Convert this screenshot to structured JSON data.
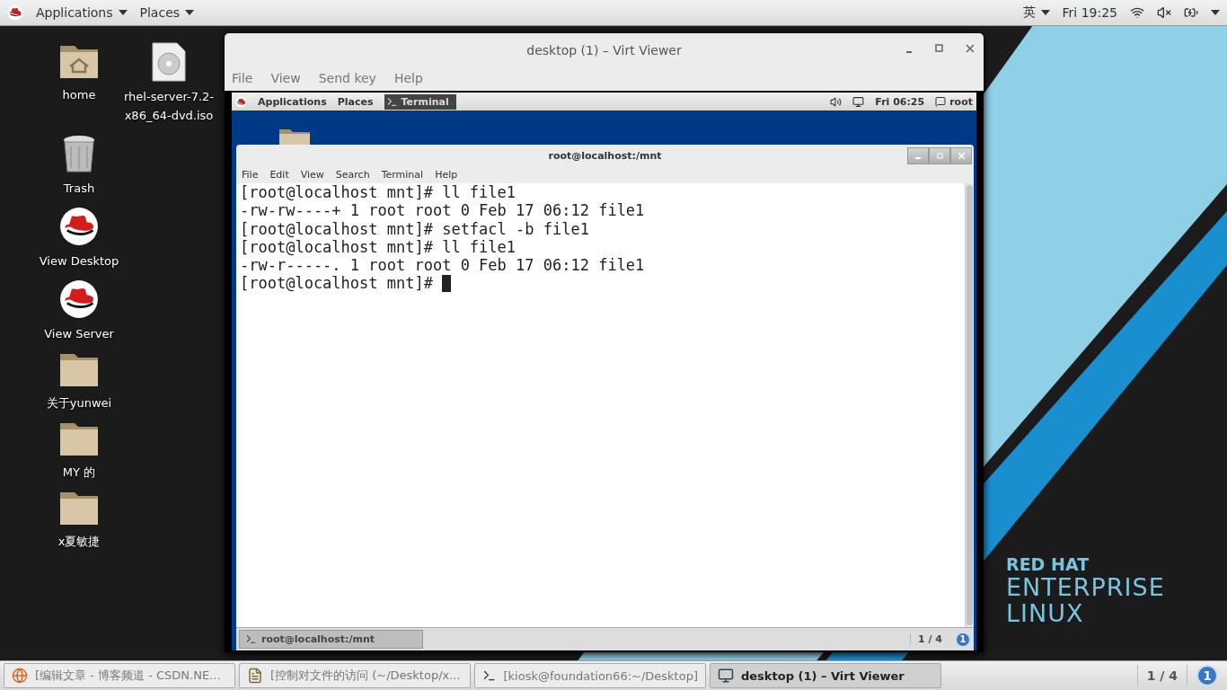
{
  "top_bar": {
    "menus": [
      {
        "label": "Applications"
      },
      {
        "label": "Places"
      }
    ],
    "input_method": "英",
    "clock": "Fri 19:25"
  },
  "desktop_icons": [
    {
      "kind": "home",
      "label": "home"
    },
    {
      "kind": "disc",
      "label": "rhel-server-7.2-x86_64-dvd.iso"
    },
    {
      "kind": "trash",
      "label": "Trash"
    },
    {
      "kind": "redhat",
      "label": "View Desktop"
    },
    {
      "kind": "redhat",
      "label": "View Server"
    },
    {
      "kind": "folder",
      "label": "关于yunwei"
    },
    {
      "kind": "folder",
      "label": "MY 的"
    },
    {
      "kind": "folder",
      "label": "x夏敏捷"
    }
  ],
  "viewer_window": {
    "title": "desktop (1) – Virt Viewer",
    "menus": [
      "File",
      "View",
      "Send key",
      "Help"
    ],
    "guest": {
      "top_bar": {
        "menus": [
          "Applications",
          "Places"
        ],
        "active_app": "Terminal",
        "clock": "Fri 06:25",
        "user": "root"
      },
      "terminal": {
        "title": "root@localhost:/mnt",
        "menus": [
          "File",
          "Edit",
          "View",
          "Search",
          "Terminal",
          "Help"
        ],
        "lines": [
          "[root@localhost mnt]# ll file1",
          "-rw-rw----+ 1 root root 0 Feb 17 06:12 file1",
          "[root@localhost mnt]# setfacl -b file1",
          "[root@localhost mnt]# ll file1",
          "-rw-r-----. 1 root root 0 Feb 17 06:12 file1",
          "[root@localhost mnt]# "
        ]
      },
      "taskbar": {
        "items": [
          {
            "label": "root@localhost:/mnt",
            "selected": true
          }
        ],
        "pager": "1 / 4",
        "badge": "1"
      }
    }
  },
  "branding": {
    "line_1": "RED HAT",
    "line_2": "ENTERPRISE",
    "line_3": "LINUX"
  },
  "taskbar": {
    "items": [
      {
        "kind": "browser",
        "label": "[编辑文章 - 博客频道 - CSDN.NE...",
        "selected": false
      },
      {
        "kind": "editor",
        "label": "[控制对文件的访问 (~/Desktop/x...",
        "selected": false
      },
      {
        "kind": "terminal",
        "label": "[kiosk@foundation66:~/Desktop]",
        "selected": false
      },
      {
        "kind": "monitor",
        "label": "desktop (1) – Virt Viewer",
        "selected": true
      }
    ],
    "pager": "1 / 4",
    "badge": "1"
  }
}
